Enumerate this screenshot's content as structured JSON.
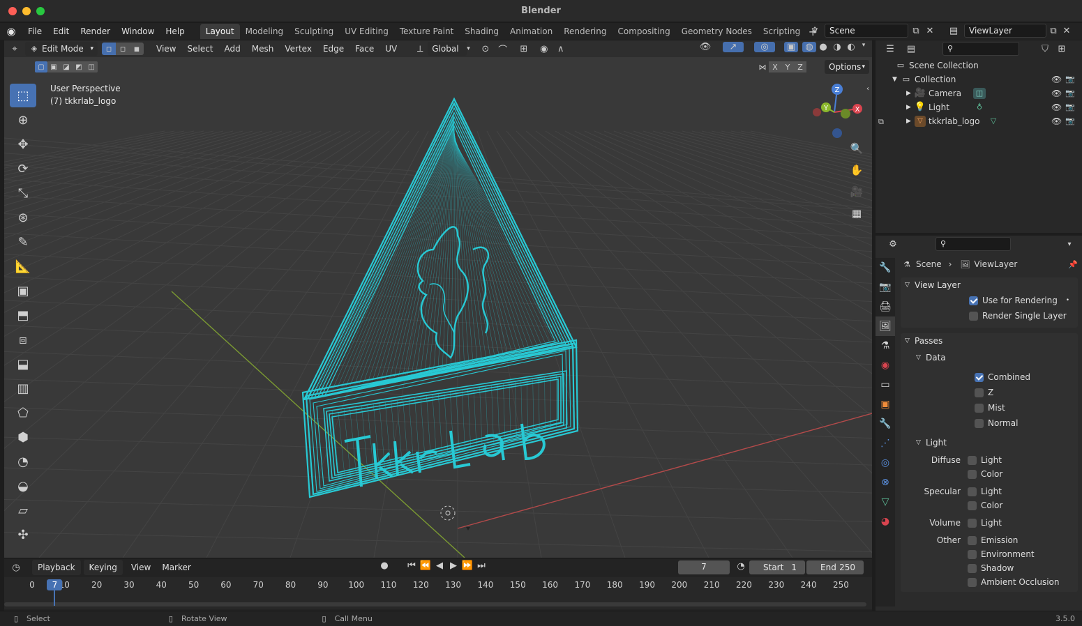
{
  "app": {
    "title": "Blender",
    "version": "3.5.0"
  },
  "menu": [
    "File",
    "Edit",
    "Render",
    "Window",
    "Help"
  ],
  "workspaces": [
    "Layout",
    "Modeling",
    "Sculpting",
    "UV Editing",
    "Texture Paint",
    "Shading",
    "Animation",
    "Rendering",
    "Compositing",
    "Geometry Nodes",
    "Scripting"
  ],
  "active_workspace": "Layout",
  "scene_field": "Scene",
  "viewlayer_field": "ViewLayer",
  "viewport": {
    "mode": "Edit Mode",
    "header_menus": [
      "View",
      "Select",
      "Add",
      "Mesh",
      "Vertex",
      "Edge",
      "Face",
      "UV"
    ],
    "orientation": "Global",
    "options_label": "Options",
    "axes": [
      "X",
      "Y",
      "Z"
    ],
    "perspective_label": "User Perspective",
    "object_label": "(7) tkkrlab_logo",
    "gizmo_axes": {
      "x": "X",
      "y": "Y",
      "z": "Z"
    },
    "mesh_text": "TkkrLab",
    "colors": {
      "wire": "#28c9d4",
      "bg": "#393939",
      "grid": "#444444",
      "x_axis": "#b34a4a",
      "y_axis": "#7b9a32"
    }
  },
  "outliner": {
    "search_placeholder": "",
    "items": [
      {
        "label": "Scene Collection",
        "icon": "collection-icon"
      },
      {
        "label": "Collection",
        "icon": "collection-icon"
      },
      {
        "label": "Camera",
        "icon": "camera-icon"
      },
      {
        "label": "Light",
        "icon": "light-icon"
      },
      {
        "label": "tkkrlab_logo",
        "icon": "mesh-icon"
      }
    ]
  },
  "properties": {
    "breadcrumb": {
      "scene": "Scene",
      "viewlayer": "ViewLayer"
    },
    "view_layer_panel": "View Layer",
    "use_for_rendering": "Use for Rendering",
    "render_single_layer": "Render Single Layer",
    "passes_panel": "Passes",
    "data_subpanel": "Data",
    "data_items": [
      {
        "label": "Combined",
        "checked": true
      },
      {
        "label": "Z",
        "checked": false
      },
      {
        "label": "Mist",
        "checked": false
      },
      {
        "label": "Normal",
        "checked": false
      }
    ],
    "light_subpanel": "Light",
    "light_groups": [
      {
        "group": "Diffuse",
        "items": [
          "Light",
          "Color"
        ]
      },
      {
        "group": "Specular",
        "items": [
          "Light",
          "Color"
        ]
      },
      {
        "group": "Volume",
        "items": [
          "Light"
        ]
      },
      {
        "group": "Other",
        "items": [
          "Emission",
          "Environment",
          "Shadow",
          "Ambient Occlusion"
        ]
      }
    ]
  },
  "timeline": {
    "menus": [
      "Playback",
      "Keying",
      "View",
      "Marker"
    ],
    "current_frame": "7",
    "start_label": "Start",
    "start": "1",
    "end_label": "End",
    "end": "250",
    "ticks": [
      "0",
      "10",
      "20",
      "30",
      "40",
      "50",
      "60",
      "70",
      "80",
      "90",
      "100",
      "110",
      "120",
      "130",
      "140",
      "150",
      "160",
      "170",
      "180",
      "190",
      "200",
      "210",
      "220",
      "230",
      "240",
      "250"
    ]
  },
  "statusbar": {
    "select": "Select",
    "rotate": "Rotate View",
    "call_menu": "Call Menu"
  }
}
